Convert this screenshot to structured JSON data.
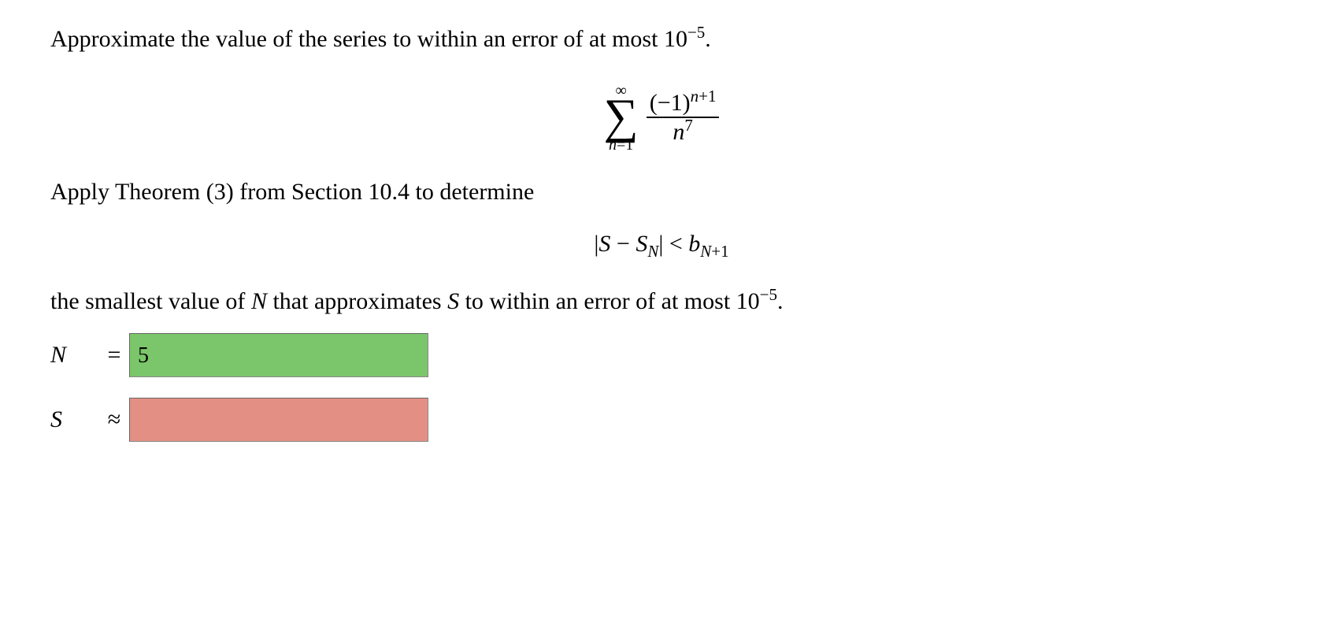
{
  "problem": {
    "intro_prefix": "Approximate the value of the series to within an error of at most ",
    "intro_bound_base": "10",
    "intro_bound_exp": "−5",
    "intro_suffix": ".",
    "series": {
      "upper": "∞",
      "lower": "n=1",
      "numerator_base": "(−1)",
      "numerator_exp": "n+1",
      "denominator_base": "n",
      "denominator_exp": "7"
    },
    "theorem_text": "Apply Theorem (3) from Section 10.4 to determine",
    "error_ineq": {
      "lhs_open": "|",
      "S": "S",
      "minus": " − ",
      "SN_S": "S",
      "SN_sub": "N",
      "lhs_close": "|",
      "lt": " < ",
      "b": "b",
      "b_sub": "N+1"
    },
    "closing_prefix": "the smallest value of ",
    "closing_N": "N",
    "closing_mid": " that approximates ",
    "closing_S": "S",
    "closing_tail_prefix": " to within an error of at most ",
    "closing_bound_base": "10",
    "closing_bound_exp": "−5",
    "closing_suffix": "."
  },
  "answers": {
    "N_label": "N",
    "N_eq": "=",
    "N_value": "5",
    "N_status": "correct",
    "S_label": "S",
    "S_eq": "≈",
    "S_value": "",
    "S_status": "incorrect"
  }
}
